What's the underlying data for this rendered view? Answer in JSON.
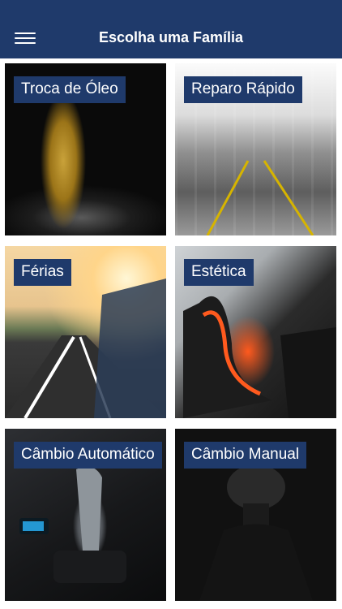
{
  "header": {
    "title": "Escolha uma Família",
    "menu_icon": "hamburger-menu-icon"
  },
  "tiles": [
    {
      "label": "Troca de Óleo"
    },
    {
      "label": "Reparo Rápido"
    },
    {
      "label": "Férias"
    },
    {
      "label": "Estética"
    },
    {
      "label": "Câmbio Automático"
    },
    {
      "label": "Câmbio Manual"
    }
  ],
  "colors": {
    "header_bg": "#1f3a6b",
    "label_bg": "#1f3a6b",
    "text": "#ffffff"
  }
}
